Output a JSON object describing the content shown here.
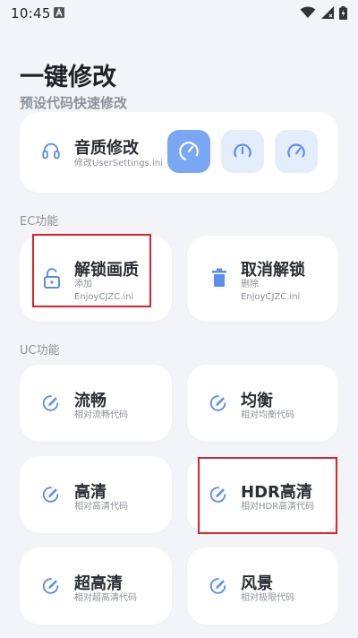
{
  "status": {
    "time": "10:45"
  },
  "header": {
    "title": "一键修改",
    "subtitle": "预设代码快速修改"
  },
  "audio": {
    "title": "音质修改",
    "subtitle": "修改UserSettings.ini"
  },
  "ec_section": {
    "label": "EC功能",
    "unlock": {
      "title": "解锁画质",
      "line1": "添加",
      "line2": "EnjoyCJZC.ini"
    },
    "cancel": {
      "title": "取消解锁",
      "line1": "删除",
      "line2": "EnjoyCJZC.ini"
    }
  },
  "uc_section": {
    "label": "UC功能",
    "items": [
      {
        "title": "流畅",
        "subtitle": "相对流畅代码"
      },
      {
        "title": "均衡",
        "subtitle": "相对均衡代码"
      },
      {
        "title": "高清",
        "subtitle": "相对高清代码"
      },
      {
        "title": "HDR高清",
        "subtitle": "相对HDR高清代码"
      },
      {
        "title": "超高清",
        "subtitle": "相对超高清代码"
      },
      {
        "title": "风景",
        "subtitle": "相对极限代码"
      }
    ]
  },
  "colors": {
    "accent": "#7aa7f3",
    "accent_light": "#e4edfb",
    "icon_blue": "#5b8ef0",
    "highlight_red": "#d9232d"
  }
}
